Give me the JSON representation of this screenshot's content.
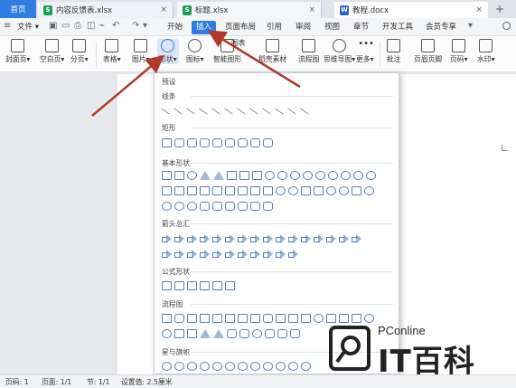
{
  "tabs": [
    {
      "label": "首页"
    },
    {
      "label": "内容反馈表.xlsx",
      "icon": "S"
    },
    {
      "label": "标题.xlsx",
      "icon": "S"
    },
    {
      "label": "教程.docx",
      "icon": "W"
    }
  ],
  "menubar": {
    "file": "文件",
    "items": [
      "开始",
      "插入",
      "页面布局",
      "引用",
      "审阅",
      "视图",
      "章节",
      "开发工具",
      "会员专享"
    ],
    "active": "插入",
    "search_label": "查找"
  },
  "ribbon": [
    {
      "label": "封面页▾"
    },
    {
      "label": "空白页▾"
    },
    {
      "label": "分页▾"
    },
    {
      "label": "表格▾"
    },
    {
      "label": "图片▾"
    },
    {
      "label": "形状▾"
    },
    {
      "label": "图标▾"
    },
    {
      "label": "智能图形"
    },
    {
      "label": "图表"
    },
    {
      "label": "稻壳素材"
    },
    {
      "label": "流程图"
    },
    {
      "label": "思维导图▾"
    },
    {
      "label": "更多▾"
    },
    {
      "label": "批注"
    },
    {
      "label": "页眉页脚"
    },
    {
      "label": "页码▾"
    },
    {
      "label": "水印▾"
    }
  ],
  "dropdown": {
    "title": "预设",
    "sections": [
      "线条",
      "矩形",
      "基本形状",
      "箭头总汇",
      "公式形状",
      "流程图",
      "星与旗帜"
    ]
  },
  "watermark": {
    "brand": "PConline",
    "title": "IT百科"
  },
  "statusbar": {
    "page": "页码: 1",
    "pages": "页面: 1/1",
    "section": "节: 1/1",
    "setting": "设置值: 2.5厘米"
  },
  "colors": {
    "accent": "#2f7de1",
    "annotation": "#b03a2e",
    "shape_stroke": "#5a7fb8"
  }
}
